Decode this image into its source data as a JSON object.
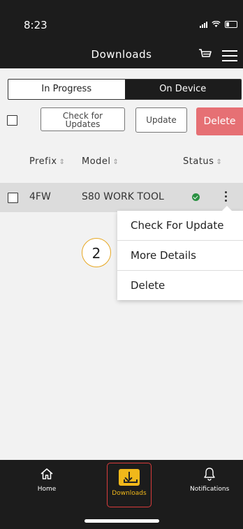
{
  "status_bar": {
    "time": "8:23"
  },
  "header": {
    "title": "Downloads",
    "cart_icon": "cart-icon",
    "menu_icon": "menu-icon"
  },
  "tabs": [
    {
      "label": "In Progress",
      "active": false
    },
    {
      "label": "On Device",
      "active": true
    }
  ],
  "actions": {
    "check_updates_label": "Check for\nUpdates",
    "update_label": "Update",
    "delete_label": "Delete"
  },
  "columns": {
    "prefix": "Prefix",
    "model": "Model",
    "status": "Status",
    "sort_symbol": "⇕"
  },
  "rows": [
    {
      "prefix": "4FW",
      "model": "S80 WORK TOOL",
      "status": "ok"
    }
  ],
  "context_menu": {
    "items": [
      "Check For Update",
      "More Details",
      "Delete"
    ]
  },
  "callout": {
    "number": "2"
  },
  "bottom_nav": {
    "items": [
      {
        "label": "Home",
        "icon": "home-icon"
      },
      {
        "label": "Downloads",
        "icon": "download-icon",
        "active": true
      },
      {
        "label": "Notifications",
        "icon": "bell-icon"
      }
    ]
  },
  "colors": {
    "dark_bar": "#1c1c1c",
    "delete_button": "#e67074",
    "accent_yellow": "#f1b81a",
    "callout_border": "#e7a823",
    "status_ok": "#2a9142"
  }
}
